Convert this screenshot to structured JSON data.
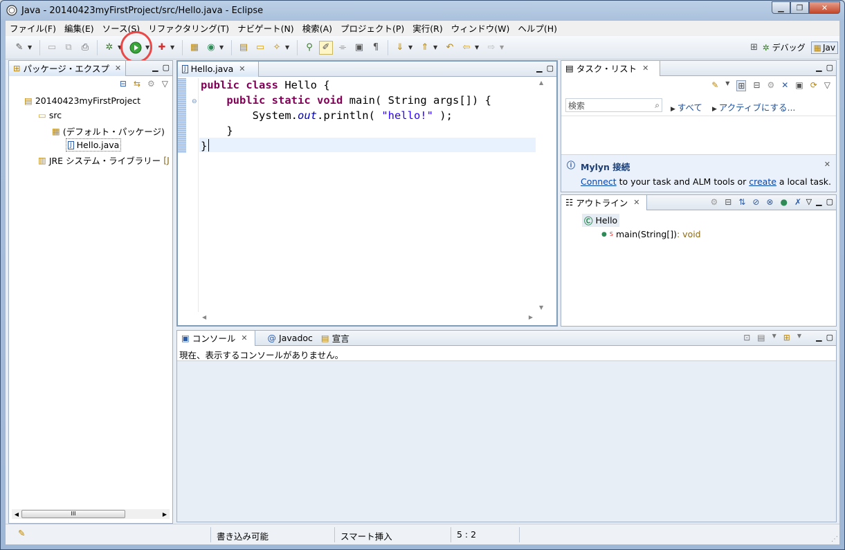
{
  "window": {
    "title": "Java - 20140423myFirstProject/src/Hello.java - Eclipse",
    "controls": [
      "▁",
      "❐",
      "✕"
    ]
  },
  "menubar": [
    "ファイル(F)",
    "編集(E)",
    "ソース(S)",
    "リファクタリング(T)",
    "ナビゲート(N)",
    "検索(A)",
    "プロジェクト(P)",
    "実行(R)",
    "ウィンドウ(W)",
    "ヘルプ(H)"
  ],
  "toolbar": {
    "perspective_debug": "デバッグ",
    "perspective_java": "Jav",
    "highlight_color": "#e84a4a"
  },
  "package_explorer": {
    "tab_label": "パッケージ・エクスプ",
    "tree": [
      {
        "label": "20140423myFirstProject"
      },
      {
        "label": "src"
      },
      {
        "label": "(デフォルト・パッケージ)"
      },
      {
        "label": "Hello.java"
      },
      {
        "label": "JRE システム・ライブラリー"
      },
      {
        "label": "[J"
      }
    ],
    "hscroll_label": "III"
  },
  "editor": {
    "tab_label": "Hello.java",
    "lines": [
      [
        {
          "c": "kw",
          "t": "public"
        },
        {
          "c": "",
          "t": " "
        },
        {
          "c": "kw",
          "t": "class"
        },
        {
          "c": "",
          "t": " Hello {"
        }
      ],
      [
        {
          "c": "",
          "t": "    "
        },
        {
          "c": "kw",
          "t": "public"
        },
        {
          "c": "",
          "t": " "
        },
        {
          "c": "kw",
          "t": "static"
        },
        {
          "c": "",
          "t": " "
        },
        {
          "c": "kw",
          "t": "void"
        },
        {
          "c": "",
          "t": " main( String args[]) {"
        }
      ],
      [
        {
          "c": "",
          "t": "        System."
        },
        {
          "c": "fld",
          "t": "out"
        },
        {
          "c": "",
          "t": ".println( "
        },
        {
          "c": "str",
          "t": "\"hello!\""
        },
        {
          "c": "",
          "t": " );"
        }
      ],
      [
        {
          "c": "",
          "t": "    }"
        }
      ],
      [
        {
          "c": "",
          "t": "}"
        }
      ]
    ]
  },
  "task_list": {
    "tab_label": "タスク・リスト",
    "search_placeholder": "検索",
    "all_link": "すべて",
    "activate_link": "アクティブにする..."
  },
  "mylyn": {
    "title": "Mylyn 接続",
    "connect": "Connect",
    "middle": " to your task and ALM tools or ",
    "create": "create",
    "tail": " a local task."
  },
  "outline": {
    "tab_label": "アウトライン",
    "class_name": "Hello",
    "method_name": "main(String[])",
    "method_return": " : void"
  },
  "console": {
    "tabs": [
      "コンソール",
      "Javadoc",
      "宣言"
    ],
    "message": "現在、表示するコンソールがありません。"
  },
  "statusbar": {
    "writable": "書き込み可能",
    "insert_mode": "スマート挿入",
    "position": "5 : 2"
  }
}
